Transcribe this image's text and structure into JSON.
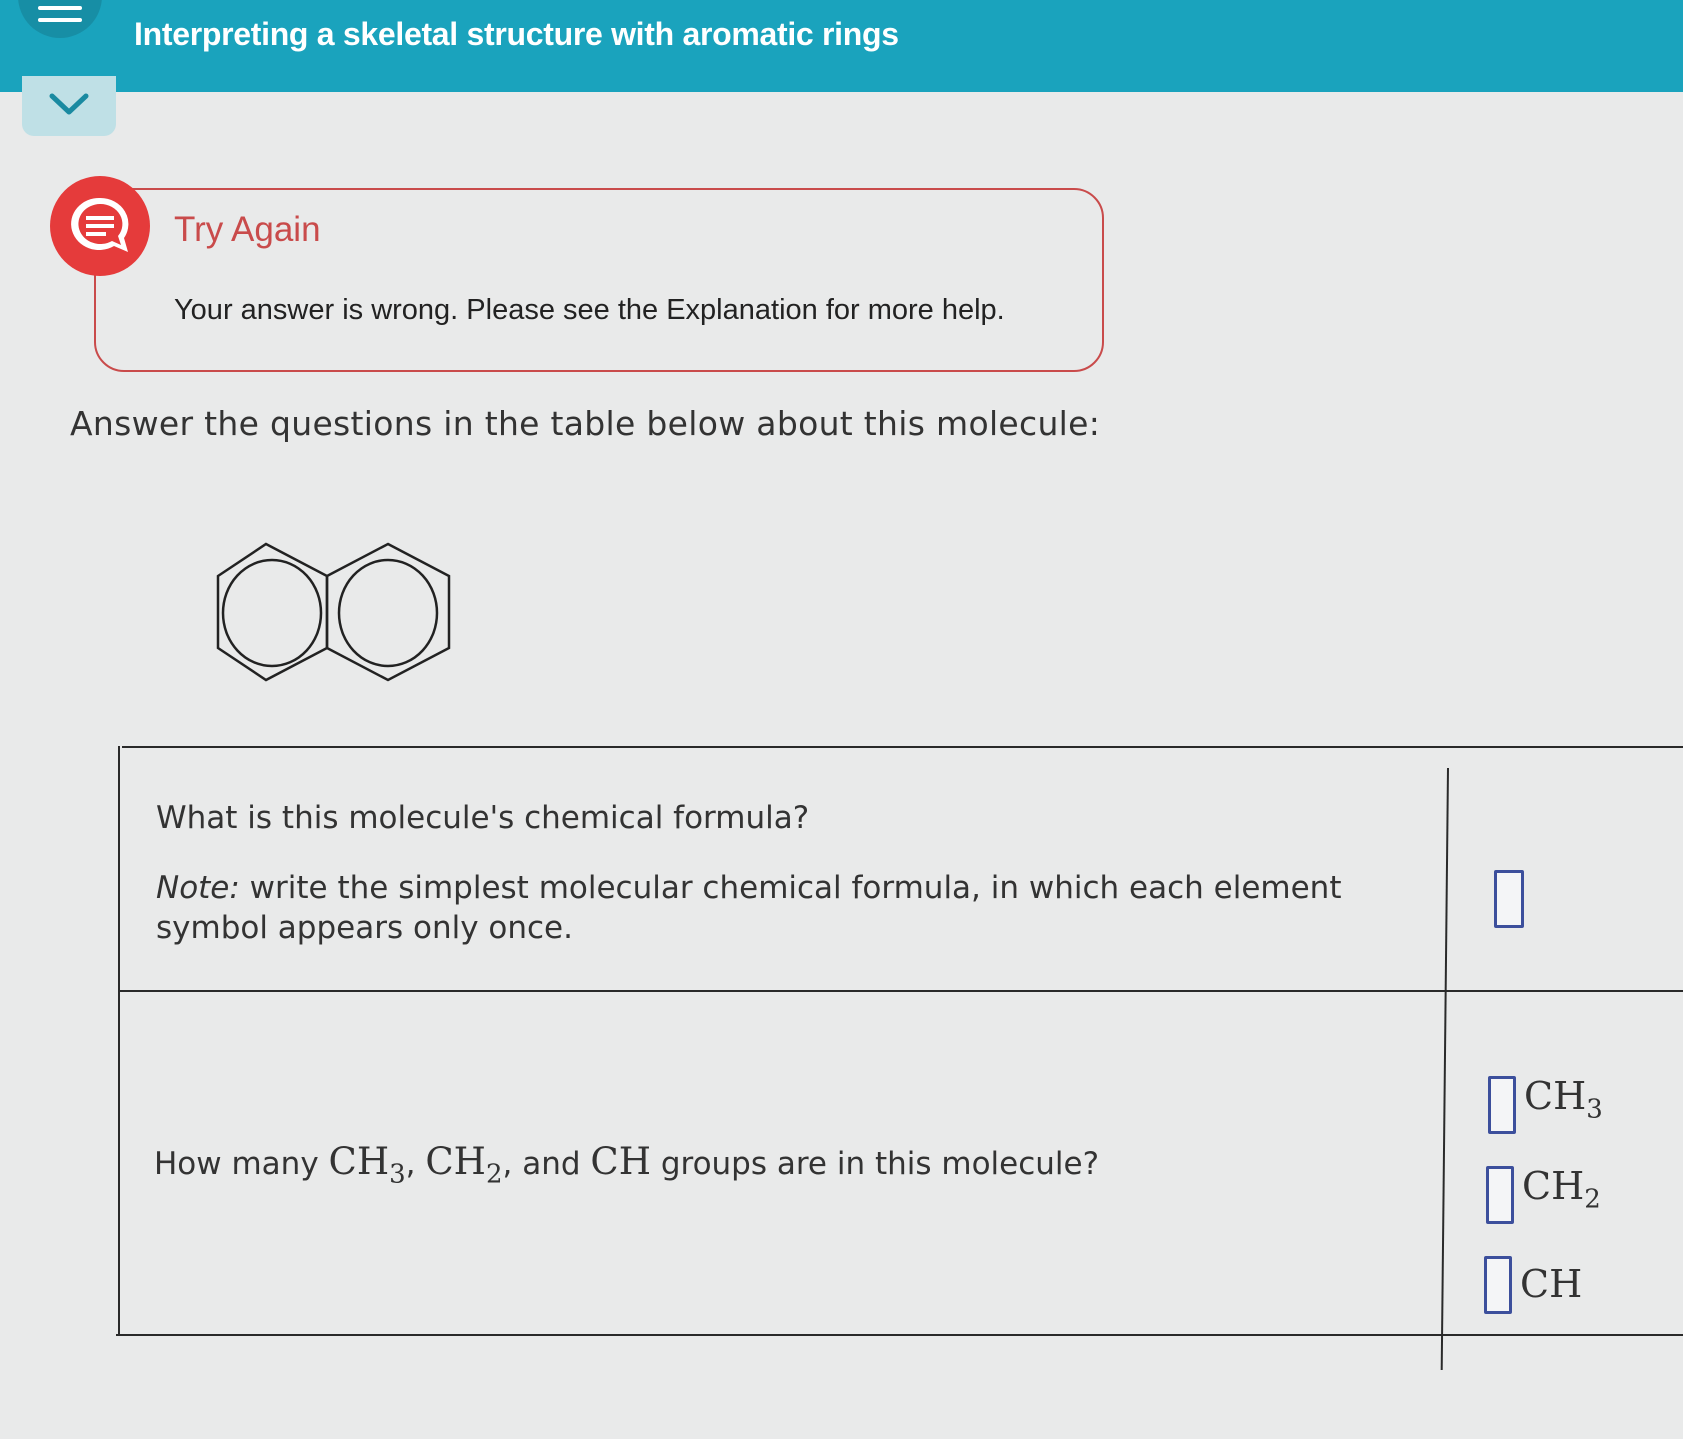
{
  "header": {
    "title": "Interpreting a skeletal structure with aromatic rings"
  },
  "feedback": {
    "title": "Try Again",
    "message": "Your answer is wrong. Please see the Explanation for more help."
  },
  "instruction": "Answer the questions in the table below about this molecule:",
  "table": {
    "q1": {
      "question": "What is this molecule's chemical formula?",
      "note_label": "Note:",
      "note_text": " write the simplest molecular chemical formula, in which each element symbol appears only once."
    },
    "q2": {
      "prefix": "How many ",
      "g1": "CH",
      "g1_sub": "3",
      "sep1": ", ",
      "g2": "CH",
      "g2_sub": "2",
      "sep2": ", and ",
      "g3": "CH",
      "suffix": " groups are in this molecule?"
    },
    "answers": {
      "ch3_label": "CH",
      "ch3_sub": "3",
      "ch2_label": "CH",
      "ch2_sub": "2",
      "ch_label": "CH"
    }
  },
  "colors": {
    "header_bg": "#1aa3bd",
    "error_red": "#e53b3b",
    "input_border": "#3c4f9c"
  },
  "icons": {
    "menu": "hamburger-icon",
    "collapse": "chevron-down-icon",
    "feedback": "speech-bubble-icon"
  }
}
